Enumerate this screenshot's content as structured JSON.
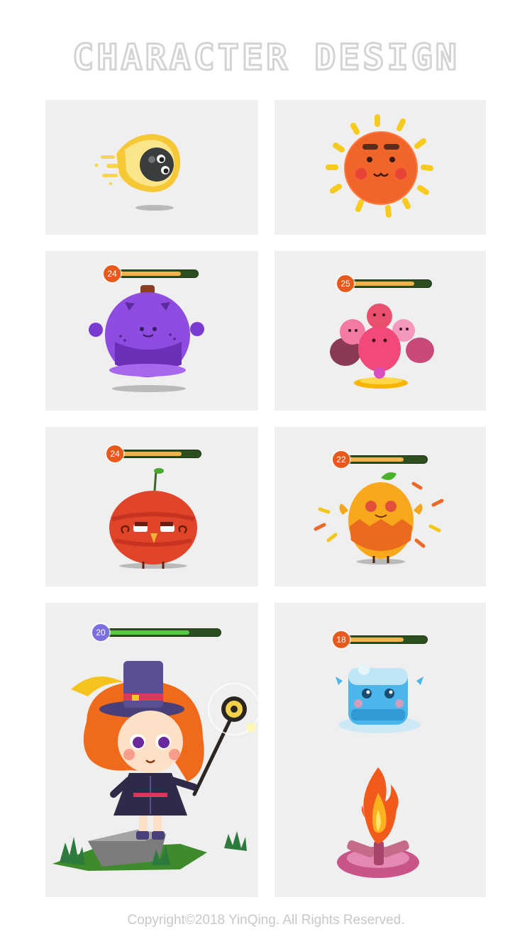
{
  "header": {
    "title": "CHARACTER DESIGN"
  },
  "cards": [
    {
      "name": "meteor-character",
      "icon": "meteor-icon"
    },
    {
      "name": "sun-character",
      "icon": "sun-icon"
    },
    {
      "name": "purple-blob-character",
      "icon": "purple-blob-icon",
      "level": "24",
      "hp": 0.78
    },
    {
      "name": "pink-creatures-character",
      "icon": "pink-creatures-icon",
      "level": "25",
      "hp": 0.78
    },
    {
      "name": "red-fruit-character",
      "icon": "red-fruit-icon",
      "level": "24",
      "hp": 0.75
    },
    {
      "name": "orange-fruit-character",
      "icon": "orange-fruit-icon",
      "level": "22",
      "hp": 0.7
    },
    {
      "name": "witch-girl-character",
      "icon": "witch-girl-icon",
      "level": "20",
      "hp": 0.72
    },
    {
      "name": "ice-block-and-campfire",
      "icon": "ice-block-icon",
      "level": "18",
      "hp": 0.7
    }
  ],
  "colors": {
    "card_bg": "#efefef",
    "badge_orange": "#e85a1c",
    "badge_purple": "#7c6ee0",
    "hp_orange": "#f3b24a",
    "hp_green": "#55c943",
    "hp_track": "#2d4f1f"
  },
  "footer": {
    "copyright": "Copyright©2018 YinQing. All Rights Reserved."
  }
}
